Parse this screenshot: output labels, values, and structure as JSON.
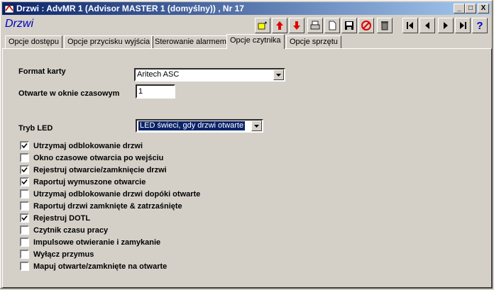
{
  "window": {
    "title": "Drzwi : AdvMR 1 (Advisor MASTER 1 (domyślny)) , Nr 17",
    "buttons": {
      "minimize": "_",
      "maximize": "□",
      "close": "X"
    }
  },
  "header": {
    "section_title": "Drzwi",
    "toolbar": [
      "find-icon",
      "arrow-up-icon",
      "arrow-down-icon",
      "print-icon",
      "new-page-icon",
      "save-icon",
      "cancel-icon",
      "delete-icon",
      "first-record-icon",
      "previous-record-icon",
      "next-record-icon",
      "last-record-icon",
      "help-icon"
    ]
  },
  "tabs": [
    {
      "label": "Opcje dostępu",
      "active": false
    },
    {
      "label": "Opcje przycisku wyjścia",
      "active": false
    },
    {
      "label": "Sterowanie alarmem",
      "active": false
    },
    {
      "label": "Opcje czytnika",
      "active": true
    },
    {
      "label": "Opcje sprzętu",
      "active": false
    }
  ],
  "form": {
    "card_format_label": "Format karty",
    "card_format_value": "Aritech ASC",
    "time_window_label": "Otwarte w oknie czasowym",
    "time_window_value": "1",
    "led_mode_label": "Tryb LED",
    "led_mode_value": "LED świeci, gdy drzwi otwarte"
  },
  "checkboxes": [
    {
      "label": "Utrzymaj odblokowanie drzwi",
      "checked": true
    },
    {
      "label": "Okno czasowe otwarcia po wejściu",
      "checked": false
    },
    {
      "label": "Rejestruj otwarcie/zamknięcie drzwi",
      "checked": true
    },
    {
      "label": "Raportuj wymuszone otwarcie",
      "checked": true
    },
    {
      "label": "Utrzymaj odblokowanie drzwi dopóki otwarte",
      "checked": false
    },
    {
      "label": "Raportuj drzwi zamknięte & zatrzaśnięte",
      "checked": false
    },
    {
      "label": "Rejestruj DOTL",
      "checked": true
    },
    {
      "label": "Czytnik czasu pracy",
      "checked": false
    },
    {
      "label": "Impulsowe otwieranie i zamykanie",
      "checked": false
    },
    {
      "label": "Wyłącz przymus",
      "checked": false
    },
    {
      "label": "Mapuj otwarte/zamknięte na otwarte",
      "checked": false
    }
  ]
}
